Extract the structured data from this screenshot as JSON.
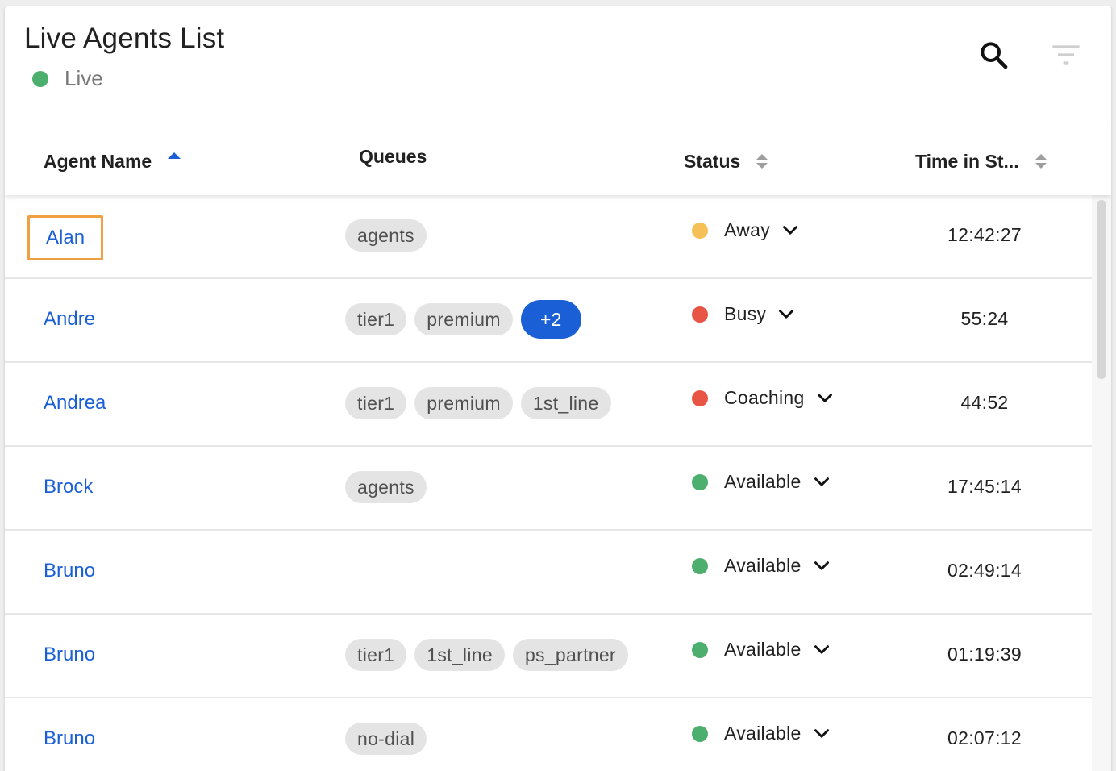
{
  "header": {
    "title": "Live Agents List",
    "live_label": "Live",
    "live_color": "#4caf6e"
  },
  "toolbar": {
    "search_icon": "search-icon",
    "filter_icon": "filter-icon"
  },
  "columns": {
    "agent_name": "Agent Name",
    "queues": "Queues",
    "status": "Status",
    "time_in_status": "Time in St..."
  },
  "status_colors": {
    "Away": "#f5c056",
    "Busy": "#e95545",
    "Coaching": "#e95545",
    "Available": "#4caf6e"
  },
  "rows": [
    {
      "name": "Alan",
      "queues": [
        "agents"
      ],
      "more": "",
      "status": "Away",
      "time": "12:42:27"
    },
    {
      "name": "Andre",
      "queues": [
        "tier1",
        "premium"
      ],
      "more": "+2",
      "status": "Busy",
      "time": "55:24"
    },
    {
      "name": "Andrea",
      "queues": [
        "tier1",
        "premium",
        "1st_line"
      ],
      "more": "",
      "status": "Coaching",
      "time": "44:52"
    },
    {
      "name": "Brock",
      "queues": [
        "agents"
      ],
      "more": "",
      "status": "Available",
      "time": "17:45:14"
    },
    {
      "name": "Bruno",
      "queues": [],
      "more": "",
      "status": "Available",
      "time": "02:49:14"
    },
    {
      "name": "Bruno",
      "queues": [
        "tier1",
        "1st_line",
        "ps_partner"
      ],
      "more": "",
      "status": "Available",
      "time": "01:19:39"
    },
    {
      "name": "Bruno",
      "queues": [
        "no-dial"
      ],
      "more": "",
      "status": "Available",
      "time": "02:07:12"
    }
  ]
}
